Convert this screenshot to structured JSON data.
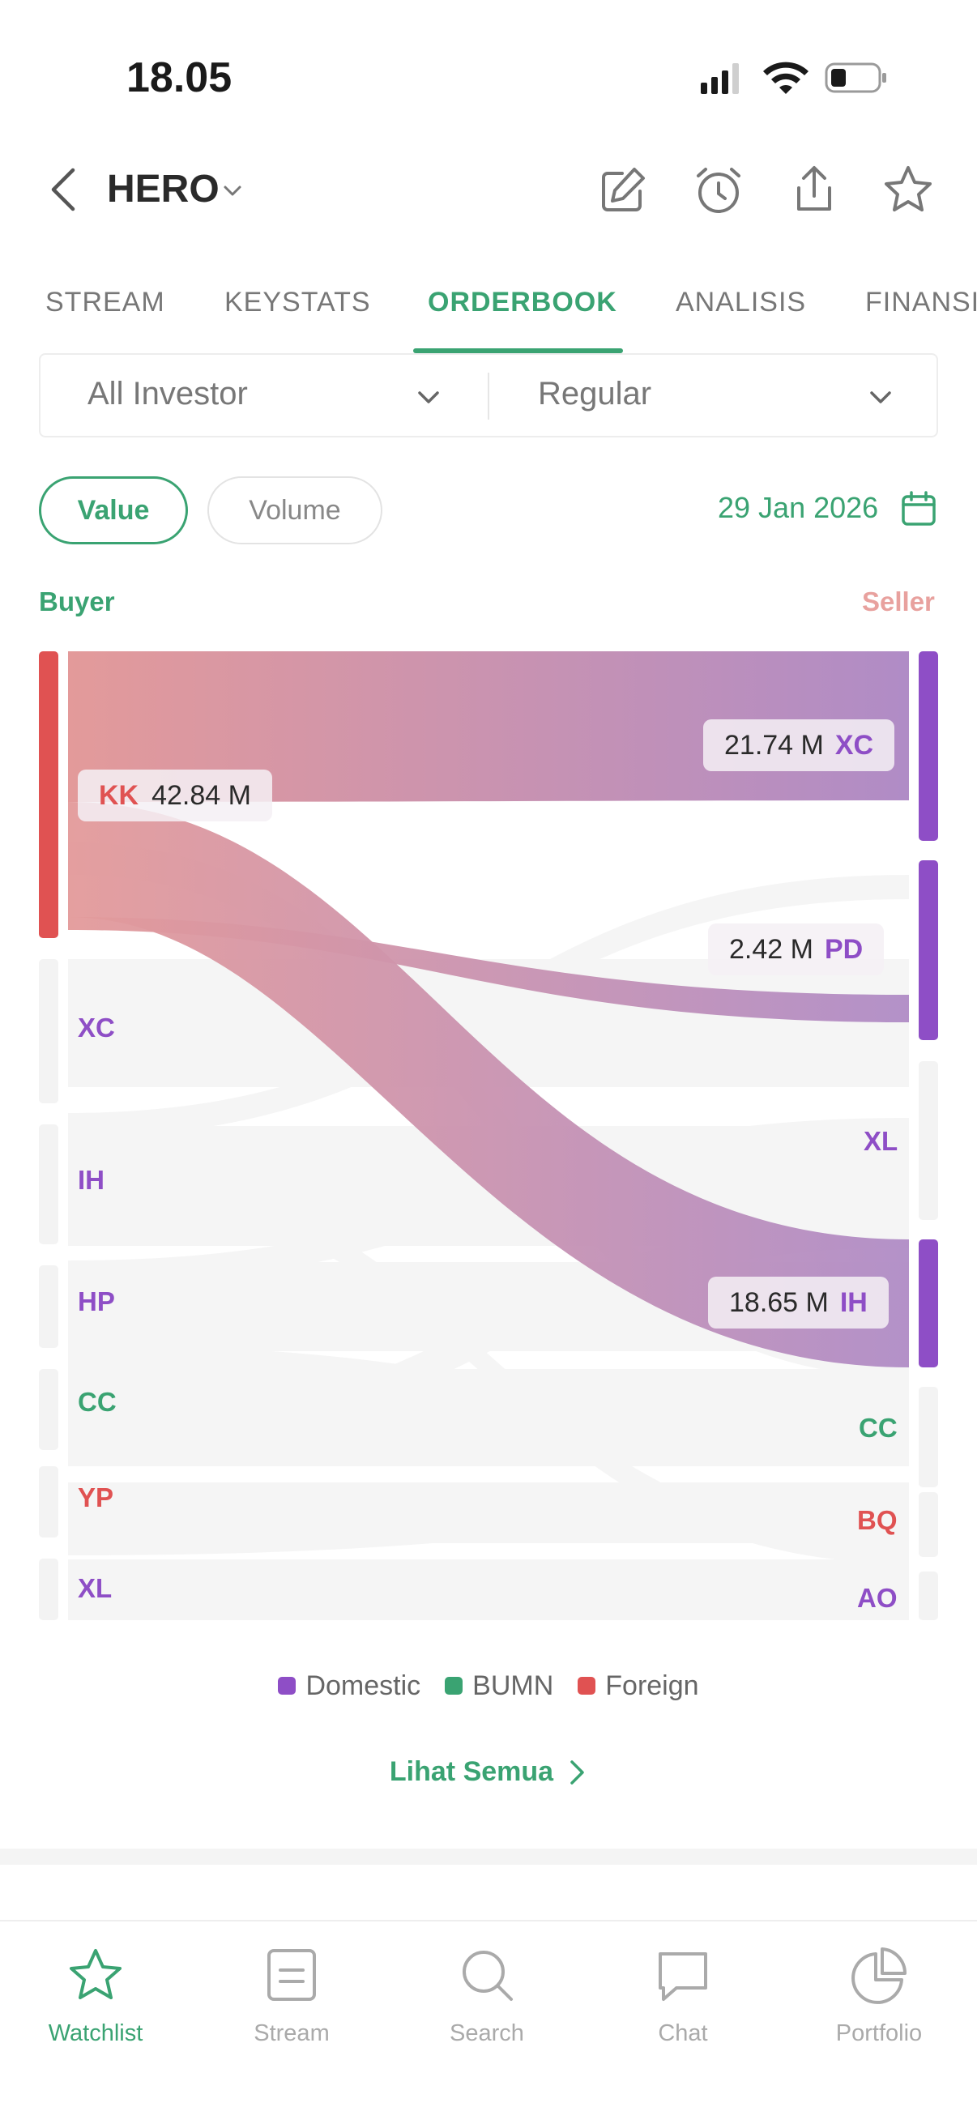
{
  "status_bar": {
    "time": "18.05"
  },
  "header": {
    "ticker": "HERO"
  },
  "tabs": [
    {
      "label": "STREAM",
      "active": false
    },
    {
      "label": "KEYSTATS",
      "active": false
    },
    {
      "label": "ORDERBOOK",
      "active": true
    },
    {
      "label": "ANALISIS",
      "active": false
    },
    {
      "label": "FINANSIAL",
      "active": false
    }
  ],
  "filters": {
    "investor": "All Investor",
    "market": "Regular"
  },
  "toggle": {
    "value_label": "Value",
    "volume_label": "Volume",
    "selected": "Value"
  },
  "date": "29 Jan 2026",
  "labels": {
    "buyer": "Buyer",
    "seller": "Seller"
  },
  "colors": {
    "accent": "#3aa372",
    "domestic": "#8e4ec6",
    "bumn": "#3aa372",
    "foreign": "#e05252",
    "seller_label": "#e8a19e"
  },
  "chart_data": {
    "type": "sankey",
    "unit": "M",
    "buyers": [
      {
        "code": "KK",
        "category": "Foreign",
        "value_label": "42.84 M",
        "highlighted": true
      },
      {
        "code": "XC",
        "category": "Domestic"
      },
      {
        "code": "IH",
        "category": "Domestic"
      },
      {
        "code": "HP",
        "category": "Domestic"
      },
      {
        "code": "CC",
        "category": "BUMN"
      },
      {
        "code": "YP",
        "category": "Foreign"
      },
      {
        "code": "XL",
        "category": "Domestic"
      }
    ],
    "sellers": [
      {
        "code": "XC",
        "category": "Domestic",
        "value_label": "21.74 M"
      },
      {
        "code": "PD",
        "category": "Domestic",
        "value_label": "2.42 M"
      },
      {
        "code": "XL",
        "category": "Domestic"
      },
      {
        "code": "IH",
        "category": "Domestic",
        "value_label": "18.65 M"
      },
      {
        "code": "CC",
        "category": "BUMN"
      },
      {
        "code": "BQ",
        "category": "Foreign"
      },
      {
        "code": "AO",
        "category": "Domestic"
      }
    ],
    "highlighted_flows": [
      {
        "from": "KK",
        "to": "XC",
        "value": 21.74
      },
      {
        "from": "KK",
        "to": "PD",
        "value": 2.42
      },
      {
        "from": "KK",
        "to": "IH",
        "value": 18.65
      }
    ],
    "legend": [
      "Domestic",
      "BUMN",
      "Foreign"
    ]
  },
  "see_all": "Lihat Semua",
  "bottom_nav": [
    {
      "label": "Watchlist",
      "icon": "star-icon",
      "active": true
    },
    {
      "label": "Stream",
      "icon": "stream-icon",
      "active": false
    },
    {
      "label": "Search",
      "icon": "search-icon",
      "active": false
    },
    {
      "label": "Chat",
      "icon": "chat-icon",
      "active": false
    },
    {
      "label": "Portfolio",
      "icon": "pie-chart-icon",
      "active": false
    }
  ]
}
